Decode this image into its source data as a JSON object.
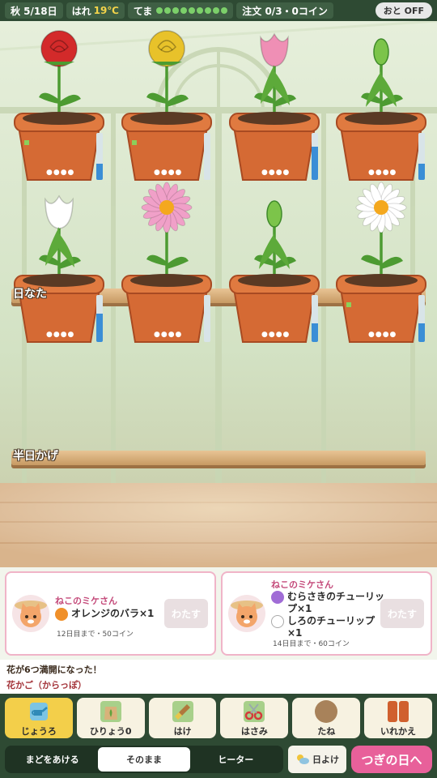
{
  "status": {
    "date": "秋 5/18日",
    "weather_label": "はれ",
    "temperature": "19℃",
    "stamina_label": "てま",
    "stamina_dots": 9,
    "orders_label": "注文 0/3・0コイン",
    "sound_label": "おと OFF"
  },
  "shelves": [
    {
      "label": "日なた",
      "plants": [
        {
          "flower": "rose",
          "color": "#d32a2a",
          "water": 0.35,
          "sprout_dot": true
        },
        {
          "flower": "rose",
          "color": "#e8c22a",
          "water": 0.0,
          "sprout_dot": true
        },
        {
          "flower": "tulip",
          "color": "#ef8fb5",
          "water": 0.7,
          "sprout_dot": false
        },
        {
          "flower": "bud",
          "color": "#7cc44a",
          "water": 0.35,
          "sprout_dot": false
        }
      ]
    },
    {
      "label": "半日かげ",
      "plants": [
        {
          "flower": "tulip",
          "color": "#ffffff",
          "water": 0.6,
          "sprout_dot": false
        },
        {
          "flower": "daisy",
          "color": "#f0a0c8",
          "water": 0.0,
          "sprout_dot": false
        },
        {
          "flower": "bud",
          "color": "#7cc44a",
          "water": 0.4,
          "sprout_dot": false
        },
        {
          "flower": "daisy",
          "color": "#ffffff",
          "water": 0.4,
          "sprout_dot": true
        }
      ]
    }
  ],
  "orders": [
    {
      "customer": "ねこのミケさん",
      "items": [
        {
          "text": "オレンジのバラ×1",
          "color": "#f0902a"
        }
      ],
      "due": "12日目まで・50コイン",
      "button": "わたす"
    },
    {
      "customer": "ねこのミケさん",
      "items": [
        {
          "text": "むらさきのチューリップ×1",
          "color": "#a06cd6"
        },
        {
          "text": "しろのチューリップ×1",
          "color": "#ffffff"
        }
      ],
      "due": "14日目まで・60コイン",
      "button": "わたす"
    }
  ],
  "log": {
    "message": "花が6つ満開になった！",
    "basket": "花かご（からっぽ）"
  },
  "tools": [
    {
      "label": "じょうろ",
      "icon": "watering-can-icon",
      "selected": true
    },
    {
      "label": "ひりょう0",
      "icon": "fertilizer-bag-icon",
      "selected": false
    },
    {
      "label": "はけ",
      "icon": "brush-icon",
      "selected": false
    },
    {
      "label": "はさみ",
      "icon": "scissors-icon",
      "selected": false
    },
    {
      "label": "たね",
      "icon": "seed-icon",
      "selected": false
    },
    {
      "label": "いれかえ",
      "icon": "swap-pot-icon",
      "selected": false
    }
  ],
  "window_modes": [
    {
      "label": "まどをあける",
      "selected": false
    },
    {
      "label": "そのまま",
      "selected": true
    },
    {
      "label": "ヒーター",
      "selected": false
    }
  ],
  "shade_label": "日よけ",
  "next_day_label": "つぎの日へ"
}
